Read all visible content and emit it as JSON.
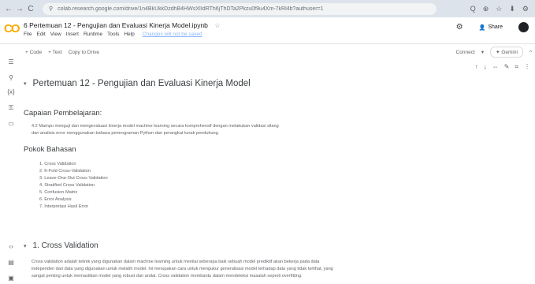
{
  "browser": {
    "url": "colab.research.google.com/drive/1n4BkUkkDzdhB4HWsXIIdRTh6jThDTa2Pkzu0f9u4Xm-7kRl4b?authuser=1",
    "nav": [
      "←",
      "→",
      "C"
    ],
    "right_icons": [
      "Q",
      "⊕",
      "☆",
      "⬇",
      "⚙"
    ]
  },
  "header": {
    "logo": "CO",
    "title": "6 Pertemuan 12 - Pengujian dan Evaluasi Kinerja Model.ipynb",
    "star": "☆",
    "menus": [
      "File",
      "Edit",
      "View",
      "Insert",
      "Runtime",
      "Tools",
      "Help"
    ],
    "unsaved": "Changes will not be saved",
    "settings_icon": "⚙",
    "share_label": "Share"
  },
  "toolbar": {
    "add_code": "+ Code",
    "add_text": "+ Text",
    "copy_to_drive": "Copy to Drive",
    "connect": "Connect",
    "gemini": "✦ Gemini"
  },
  "cell_tools": [
    "↑",
    "↓",
    "⇔",
    "✎",
    "⌗",
    "⋮"
  ],
  "section1": {
    "caret": "▾",
    "title": "Pertemuan 12 - Pengujian dan Evaluasi Kinerja Model",
    "capaian_heading": "Capaian Pembelajaran:",
    "capaian_text_1": "4.2 Mampu menguji dan mengevaluasi kinerja model machine learning secara komprehensif dengan melakukan validasi silang",
    "capaian_text_2": "dan analisis error menggunakan bahasa pemrograman Python dan perangkat lunak pendukung.",
    "pokok_heading": "Pokok Bahasan",
    "pokok_items": [
      "1. Cross Validation",
      "2. K-Fold Cross-Validation",
      "3. Leave-One-Out Cross Validation",
      "4. Stratified Cross Validation",
      "5. Confusion Matrix",
      "6. Error Analysis",
      "7. Interpretasi Hasil Error"
    ]
  },
  "section2": {
    "caret": "▾",
    "title": "1. Cross Validation",
    "text_1": "Cross validation adalah teknik yang digunakan dalam machine learning untuk menilai seberapa baik sebuah model prediktif akan bekerja pada data",
    "text_2": "independen dari data yang digunakan untuk melatih model. Ini merupakan cara untuk mengukur generalisasi model terhadap data yang tidak terlihat, yang",
    "text_3": "sangat penting untuk memastikan model yang robust dan andal. Cross validation membantu dalam mendeteksi masalah seperti overfitting."
  }
}
